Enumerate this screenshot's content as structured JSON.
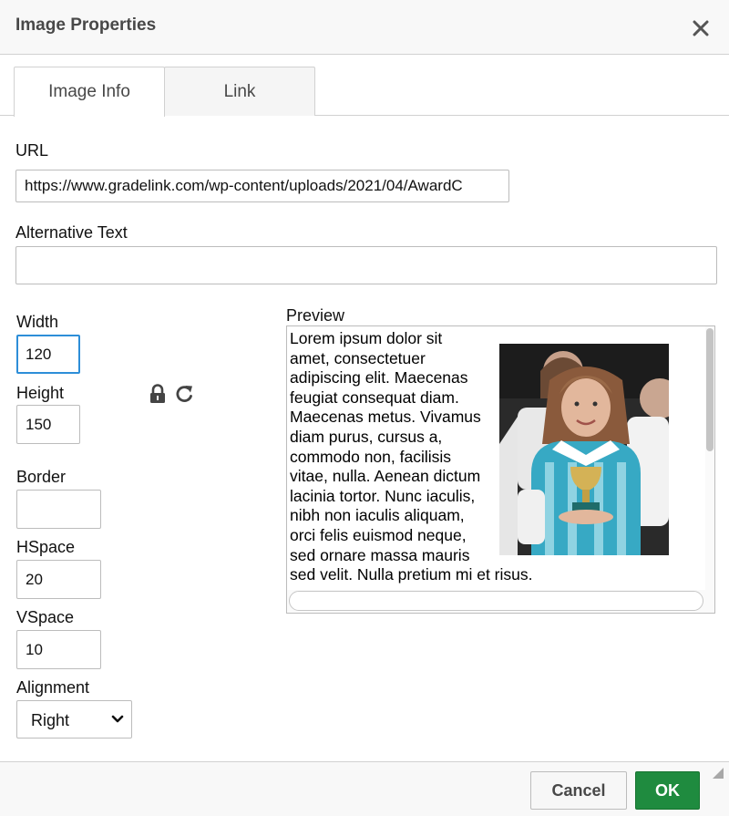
{
  "dialog": {
    "title": "Image Properties"
  },
  "tabs": [
    {
      "label": "Image Info",
      "active": true
    },
    {
      "label": "Link",
      "active": false
    }
  ],
  "fields": {
    "url": {
      "label": "URL",
      "value": "https://www.gradelink.com/wp-content/uploads/2021/04/AwardC"
    },
    "alt": {
      "label": "Alternative Text",
      "value": ""
    },
    "width": {
      "label": "Width",
      "value": "120"
    },
    "height": {
      "label": "Height",
      "value": "150"
    },
    "border": {
      "label": "Border",
      "value": ""
    },
    "hspace": {
      "label": "HSpace",
      "value": "20"
    },
    "vspace": {
      "label": "VSpace",
      "value": "10"
    },
    "alignment": {
      "label": "Alignment",
      "value": "Right"
    }
  },
  "preview": {
    "label": "Preview",
    "text": "Lorem ipsum dolor sit amet, consectetuer adipiscing elit. Maecenas feugiat consequat diam. Maecenas metus. Vivamus diam purus, cursus a, commodo non, facilisis vitae, nulla. Aenean dictum lacinia tortor. Nunc iaculis, nibh non iaculis aliquam, orci felis euismod neque, sed ornare massa mauris sed velit. Nulla pretium mi et risus."
  },
  "buttons": {
    "cancel": "Cancel",
    "ok": "OK"
  },
  "icons": {
    "close": "close-icon",
    "lock": "lock-icon",
    "reset": "reset-size-icon",
    "dropdown": "chevron-down-icon",
    "resize": "resize-grip-icon"
  },
  "colors": {
    "ok_button": "#1f8b3f",
    "focus_border": "#2d8ed8"
  }
}
